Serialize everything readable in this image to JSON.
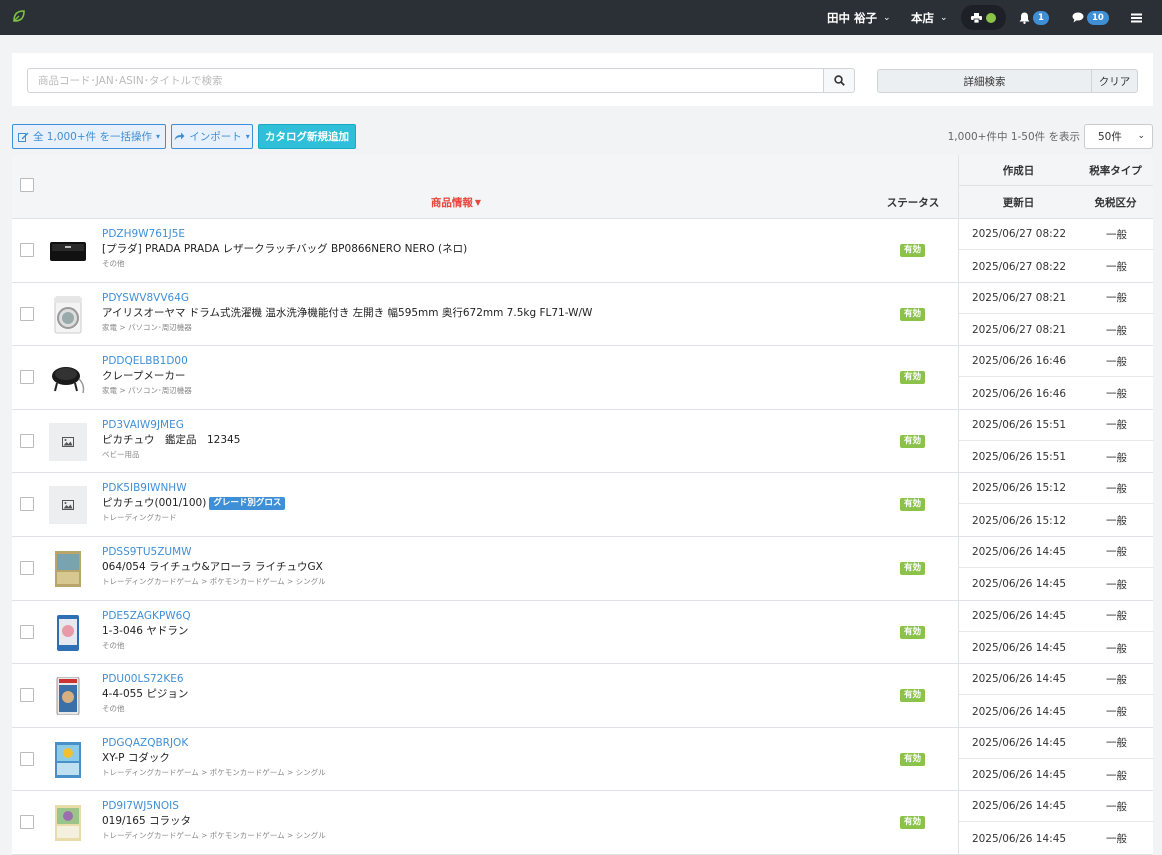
{
  "topbar": {
    "user_name": "田中 裕子",
    "store": "本店",
    "notifications_count": "1",
    "messages_count": "10",
    "printer_status_color": "#8bc34a"
  },
  "search": {
    "placeholder": "商品コード･JAN･ASIN･タイトルで検索",
    "advanced_label": "詳細検索",
    "clear_label": "クリア"
  },
  "actions": {
    "bulk_label": "全 1,000+件 を一括操作",
    "import_label": "インポート",
    "add_label": "カタログ新規追加",
    "count_text": "1,000+件中 1-50件 を表示",
    "per_page": "50件"
  },
  "table": {
    "headers": {
      "product": "商品情報",
      "status": "ステータス",
      "created": "作成日",
      "updated": "更新日",
      "tax_type": "税率タイプ",
      "exempt": "免税区分"
    },
    "rows": [
      {
        "code": "PDZH9W761J5E",
        "title": "[プラダ] PRADA PRADA レザークラッチバッグ BP0866NERO NERO (ネロ)",
        "tag": "",
        "category": "その他",
        "status": "有効",
        "created": "2025/06/27 08:22",
        "updated": "2025/06/27 08:22",
        "tax": "一般",
        "exempt": "一般",
        "thumb": "clutch-bag"
      },
      {
        "code": "PDYSWV8VV64G",
        "title": "アイリスオーヤマ ドラム式洗濯機 温水洗浄機能付き 左開き 幅595mm 奥行672mm 7.5kg FL71-W/W",
        "tag": "",
        "category": "家電 > パソコン･周辺機器",
        "status": "有効",
        "created": "2025/06/27 08:21",
        "updated": "2025/06/27 08:21",
        "tax": "一般",
        "exempt": "一般",
        "thumb": "washing-machine"
      },
      {
        "code": "PDDQELBB1D00",
        "title": "クレープメーカー",
        "tag": "",
        "category": "家電 > パソコン･周辺機器",
        "status": "有効",
        "created": "2025/06/26 16:46",
        "updated": "2025/06/26 16:46",
        "tax": "一般",
        "exempt": "一般",
        "thumb": "crepe-maker"
      },
      {
        "code": "PD3VAIW9JMEG",
        "title": "ピカチュウ　鑑定品　12345",
        "tag": "",
        "category": "ベビー用品",
        "status": "有効",
        "created": "2025/06/26 15:51",
        "updated": "2025/06/26 15:51",
        "tax": "一般",
        "exempt": "一般",
        "thumb": "placeholder"
      },
      {
        "code": "PDK5IB9IWNHW",
        "title": "ピカチュウ(001/100)",
        "tag": "グレード別グロス",
        "category": "トレーディングカード",
        "status": "有効",
        "created": "2025/06/26 15:12",
        "updated": "2025/06/26 15:12",
        "tax": "一般",
        "exempt": "一般",
        "thumb": "placeholder"
      },
      {
        "code": "PDSS9TU5ZUMW",
        "title": "064/054 ライチュウ&アローラ ライチュウGX",
        "tag": "",
        "category": "トレーディングカードゲーム > ポケモンカードゲーム > シングル",
        "status": "有効",
        "created": "2025/06/26 14:45",
        "updated": "2025/06/26 14:45",
        "tax": "一般",
        "exempt": "一般",
        "thumb": "card-gold"
      },
      {
        "code": "PDE5ZAGKPW6Q",
        "title": "1-3-046 ヤドラン",
        "tag": "",
        "category": "その他",
        "status": "有効",
        "created": "2025/06/26 14:45",
        "updated": "2025/06/26 14:45",
        "tax": "一般",
        "exempt": "一般",
        "thumb": "card-blue"
      },
      {
        "code": "PDU00LS72KE6",
        "title": "4-4-055 ピジョン",
        "tag": "",
        "category": "その他",
        "status": "有効",
        "created": "2025/06/26 14:45",
        "updated": "2025/06/26 14:45",
        "tax": "一般",
        "exempt": "一般",
        "thumb": "card-slab"
      },
      {
        "code": "PDGQAZQBRJOK",
        "title": "XY-P コダック",
        "tag": "",
        "category": "トレーディングカードゲーム > ポケモンカードゲーム > シングル",
        "status": "有効",
        "created": "2025/06/26 14:45",
        "updated": "2025/06/26 14:45",
        "tax": "一般",
        "exempt": "一般",
        "thumb": "card-psyduck"
      },
      {
        "code": "PD9I7WJ5NOIS",
        "title": "019/165 コラッタ",
        "tag": "",
        "category": "トレーディングカードゲーム > ポケモンカードゲーム > シングル",
        "status": "有効",
        "created": "2025/06/26 14:45",
        "updated": "2025/06/26 14:45",
        "tax": "一般",
        "exempt": "一般",
        "thumb": "card-rattata"
      }
    ]
  }
}
